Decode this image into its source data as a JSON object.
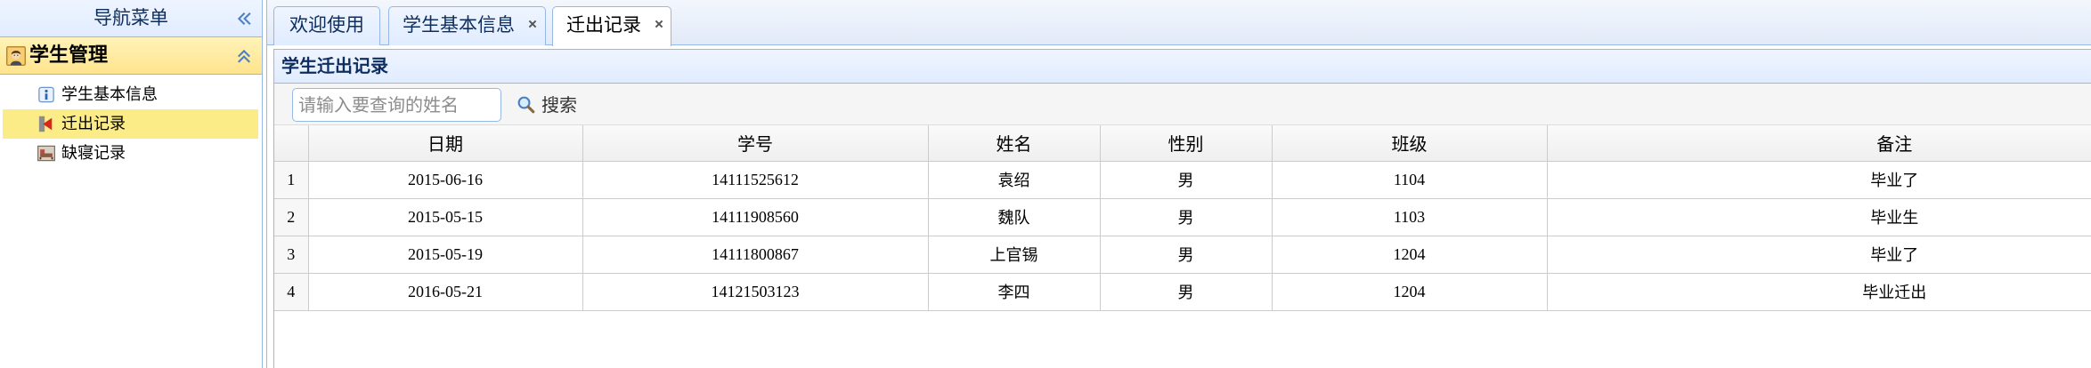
{
  "colors": {
    "border": "#95b8e7",
    "header_gradient_top": "#eff5ff",
    "header_gradient_bottom": "#e0ecff",
    "accordion_selected": "#ffe48d",
    "tree_selected": "#fbec88",
    "grid_line": "#cccccc",
    "title_text": "#0e2d5f"
  },
  "sidebar": {
    "title": "导航菜单",
    "collapse_icon": "double-chevron-left-icon",
    "group": {
      "title": "学生管理",
      "icon": "student-icon",
      "toggle_icon": "double-chevron-up-icon",
      "items": [
        {
          "label": "学生基本信息",
          "icon": "info-icon",
          "selected": false
        },
        {
          "label": "迁出记录",
          "icon": "exit-record-icon",
          "selected": true
        },
        {
          "label": "缺寝记录",
          "icon": "dorm-absence-icon",
          "selected": false
        }
      ]
    }
  },
  "tabs": [
    {
      "label": "欢迎使用",
      "closable": false,
      "selected": false
    },
    {
      "label": "学生基本信息",
      "closable": true,
      "selected": false,
      "close_icon": "close-icon"
    },
    {
      "label": "迁出记录",
      "closable": true,
      "selected": true,
      "close_icon": "close-icon"
    }
  ],
  "panel": {
    "title": "学生迁出记录",
    "search": {
      "placeholder": "请输入要查询的姓名"
    },
    "search_button": {
      "label": "搜索",
      "icon": "search-icon"
    }
  },
  "grid": {
    "columns": [
      "日期",
      "学号",
      "姓名",
      "性别",
      "班级",
      "备注"
    ],
    "rows": [
      {
        "number": "1",
        "cells": [
          "2015-06-16",
          "14111525612",
          "袁绍",
          "男",
          "1104",
          "毕业了"
        ]
      },
      {
        "number": "2",
        "cells": [
          "2015-05-15",
          "14111908560",
          "魏队",
          "男",
          "1103",
          "毕业生"
        ]
      },
      {
        "number": "3",
        "cells": [
          "2015-05-19",
          "14111800867",
          "上官锡",
          "男",
          "1204",
          "毕业了"
        ]
      },
      {
        "number": "4",
        "cells": [
          "2016-05-21",
          "14121503123",
          "李四",
          "男",
          "1204",
          "毕业迁出"
        ]
      }
    ]
  }
}
